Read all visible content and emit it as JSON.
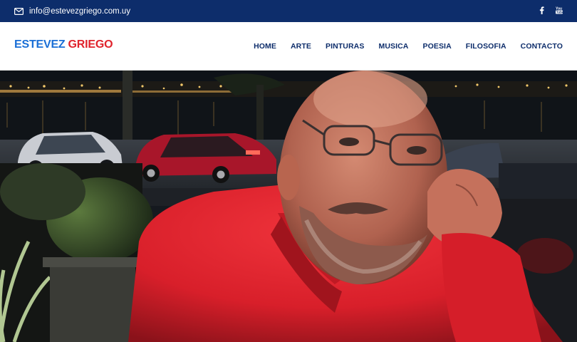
{
  "topbar": {
    "email": "info@estevezgriego.com.uy",
    "icons": [
      "mail-icon",
      "facebook-icon",
      "youtube-icon"
    ],
    "background": "#0d2d6b"
  },
  "header": {
    "logo_part1": "ESTEVEZ",
    "logo_part2": "GRIEGO",
    "logo_colors": [
      "#1a6fd6",
      "#e0232c"
    ],
    "nav": [
      {
        "label": "HOME"
      },
      {
        "label": "ARTE"
      },
      {
        "label": "PINTURAS"
      },
      {
        "label": "MUSICA"
      },
      {
        "label": "POESIA"
      },
      {
        "label": "FILOSOFIA"
      },
      {
        "label": "CONTACTO"
      }
    ],
    "nav_color": "#0d2d6b"
  },
  "hero": {
    "image_subject": "portrait-photo"
  }
}
